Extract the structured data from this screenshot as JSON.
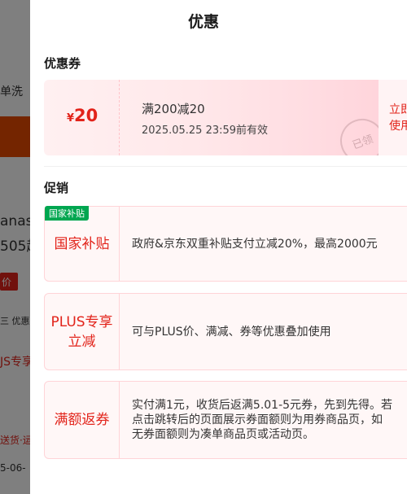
{
  "background_page": {
    "fragments": [
      "单洗",
      "anas",
      "505起",
      "价",
      "三 优惠",
      "JS专享",
      "送货·运",
      "5-06-"
    ]
  },
  "drawer": {
    "title": "优惠",
    "coupon_section": {
      "label": "优惠券",
      "coupon": {
        "currency": "¥",
        "amount": "20",
        "condition": "满200减20",
        "expiry": "2025.05.25 23:59前有效",
        "stamp": "已领",
        "action": "立即使用"
      }
    },
    "promo_section": {
      "label": "促销",
      "items": [
        {
          "tag": "国家补贴",
          "name": "国家补贴",
          "desc": "政府&京东双重补贴支付立减20%，最高2000元"
        },
        {
          "name": "PLUS专享立减",
          "desc": "可与PLUS价、满减、券等优惠叠加使用",
          "arrow": "›"
        },
        {
          "name": "满额返券",
          "desc": "实付满1元，收货后返满5.01-5元券，先到先得。若点击跳转后的页面展示券面额则为用券商品页，如无券面额则为凑单商品页或活动页。"
        }
      ]
    }
  },
  "colors": {
    "accent": "#e2231a",
    "tag_green": "#00a650",
    "overlay": "rgba(0,0,0,0.5)"
  }
}
